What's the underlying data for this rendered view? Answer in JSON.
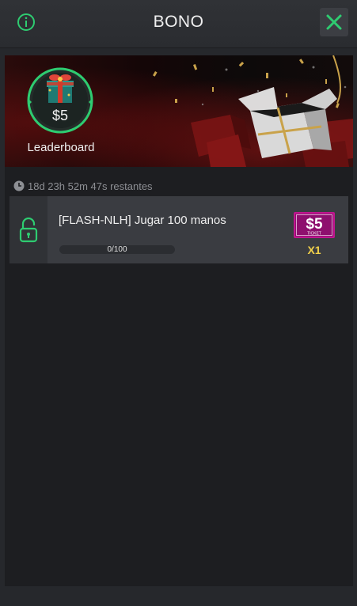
{
  "header": {
    "title": "BONO",
    "info_icon": "info-icon",
    "close_icon": "close-icon"
  },
  "banner": {
    "badge_amount": "$5",
    "badge_label": "Leaderboard",
    "gift_icon": "gift-box-icon"
  },
  "timer": {
    "icon": "clock-icon",
    "text": "18d 23h 52m 47s restantes"
  },
  "tasks": [
    {
      "title": "[FLASH-NLH] Jugar 100 manos",
      "progress_text": "0/100",
      "progress_fraction": 0,
      "reward_ticket_value": "$5",
      "reward_ticket_label": "TICKET",
      "reward_multiplier": "X1",
      "lock_icon": "unlocked-padlock-icon"
    }
  ],
  "colors": {
    "accent_green": "#2ecc71",
    "ticket_magenta": "#c0168f",
    "multiplier_gold": "#f3d24a"
  }
}
